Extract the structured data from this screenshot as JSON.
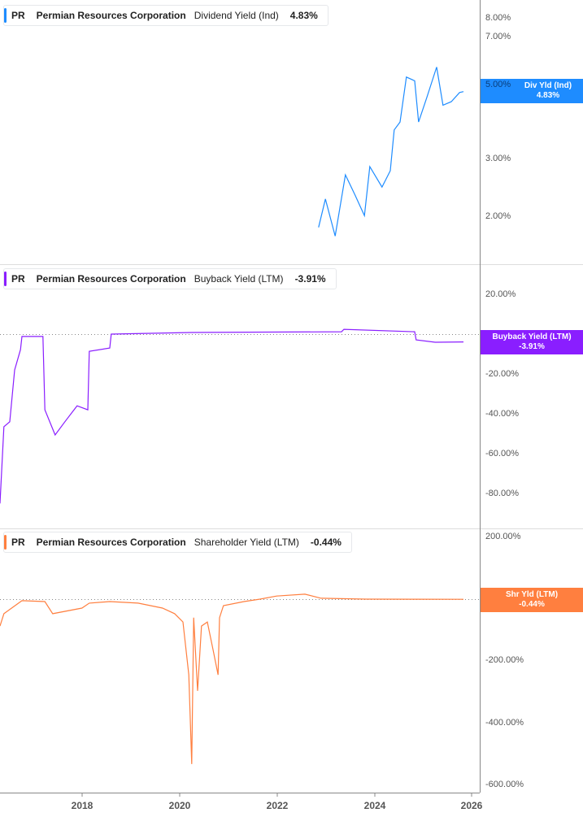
{
  "chart_data": [
    {
      "type": "line",
      "ticker": "PR",
      "company": "Permian Resources Corporation",
      "metric": "Dividend Yield (Ind)",
      "value": "4.83%",
      "tag_label": "Div Yld (Ind)",
      "color": "#1e8cff",
      "scale": "log",
      "yticks": [
        "8.00%",
        "7.00%",
        "5.00%",
        "3.00%",
        "2.00%"
      ],
      "x": [
        2022.85,
        2022.99,
        2023.19,
        2023.4,
        2023.6,
        2023.79,
        2023.9,
        2024.15,
        2024.32,
        2024.4,
        2024.52,
        2024.65,
        2024.82,
        2024.9,
        2025.07,
        2025.27,
        2025.4,
        2025.57,
        2025.74,
        2025.82
      ],
      "y": [
        1.86,
        2.27,
        1.75,
        2.69,
        2.33,
        2.02,
        2.85,
        2.47,
        2.77,
        3.69,
        3.9,
        5.35,
        5.21,
        3.9,
        4.64,
        5.74,
        4.39,
        4.5,
        4.8,
        4.83
      ]
    },
    {
      "type": "line",
      "ticker": "PR",
      "company": "Permian Resources Corporation",
      "metric": "Buyback Yield (LTM)",
      "value": "-3.91%",
      "tag_label": "Buyback Yield (LTM)",
      "color": "#8a1eff",
      "scale": "linear",
      "yticks": [
        "20.00%",
        "-20.00%",
        "-40.00%",
        "-60.00%",
        "-80.00%"
      ],
      "x": [
        2016.32,
        2016.4,
        2016.52,
        2016.62,
        2016.74,
        2016.77,
        2017.2,
        2017.24,
        2017.45,
        2017.65,
        2017.9,
        2018.12,
        2018.15,
        2018.57,
        2018.6,
        2020.24,
        2023.32,
        2023.37,
        2024.82,
        2024.85,
        2025.24,
        2025.82
      ],
      "y": [
        -85,
        -46.5,
        -44,
        -18,
        -7.8,
        -1.2,
        -1.2,
        -38,
        -50.6,
        -44,
        -36,
        -38,
        -8.6,
        -7,
        0,
        0.8,
        1.2,
        2.4,
        1.2,
        -2.9,
        -4.1,
        -3.91
      ]
    },
    {
      "type": "line",
      "ticker": "PR",
      "company": "Permian Resources Corporation",
      "metric": "Shareholder Yield (LTM)",
      "value": "-0.44%",
      "tag_label": "Shr Yld (LTM)",
      "color": "#ff7f3f",
      "scale": "linear",
      "yticks": [
        "200.00%",
        "-200.00%",
        "-400.00%",
        "-600.00%"
      ],
      "x": [
        2016.32,
        2016.4,
        2016.77,
        2017.24,
        2017.4,
        2018.0,
        2018.15,
        2018.57,
        2019.15,
        2019.65,
        2019.9,
        2020.07,
        2020.19,
        2020.25,
        2020.29,
        2020.37,
        2020.45,
        2020.57,
        2020.69,
        2020.79,
        2020.82,
        2020.9,
        2021.32,
        2021.65,
        2021.99,
        2022.57,
        2022.9,
        2023.82,
        2025.82
      ],
      "y": [
        -87,
        -47,
        -5,
        -8,
        -47,
        -29,
        -13,
        -8,
        -13,
        -29,
        -47,
        -74,
        -245,
        -534,
        -60,
        -297,
        -87,
        -74,
        -166,
        -245,
        -60,
        -21,
        -8,
        0,
        10,
        16,
        3,
        0,
        -0.44
      ]
    }
  ],
  "x_axis": {
    "ticks": [
      "2018",
      "2020",
      "2022",
      "2024",
      "2026"
    ],
    "range": [
      2016.32,
      2026.3
    ]
  }
}
